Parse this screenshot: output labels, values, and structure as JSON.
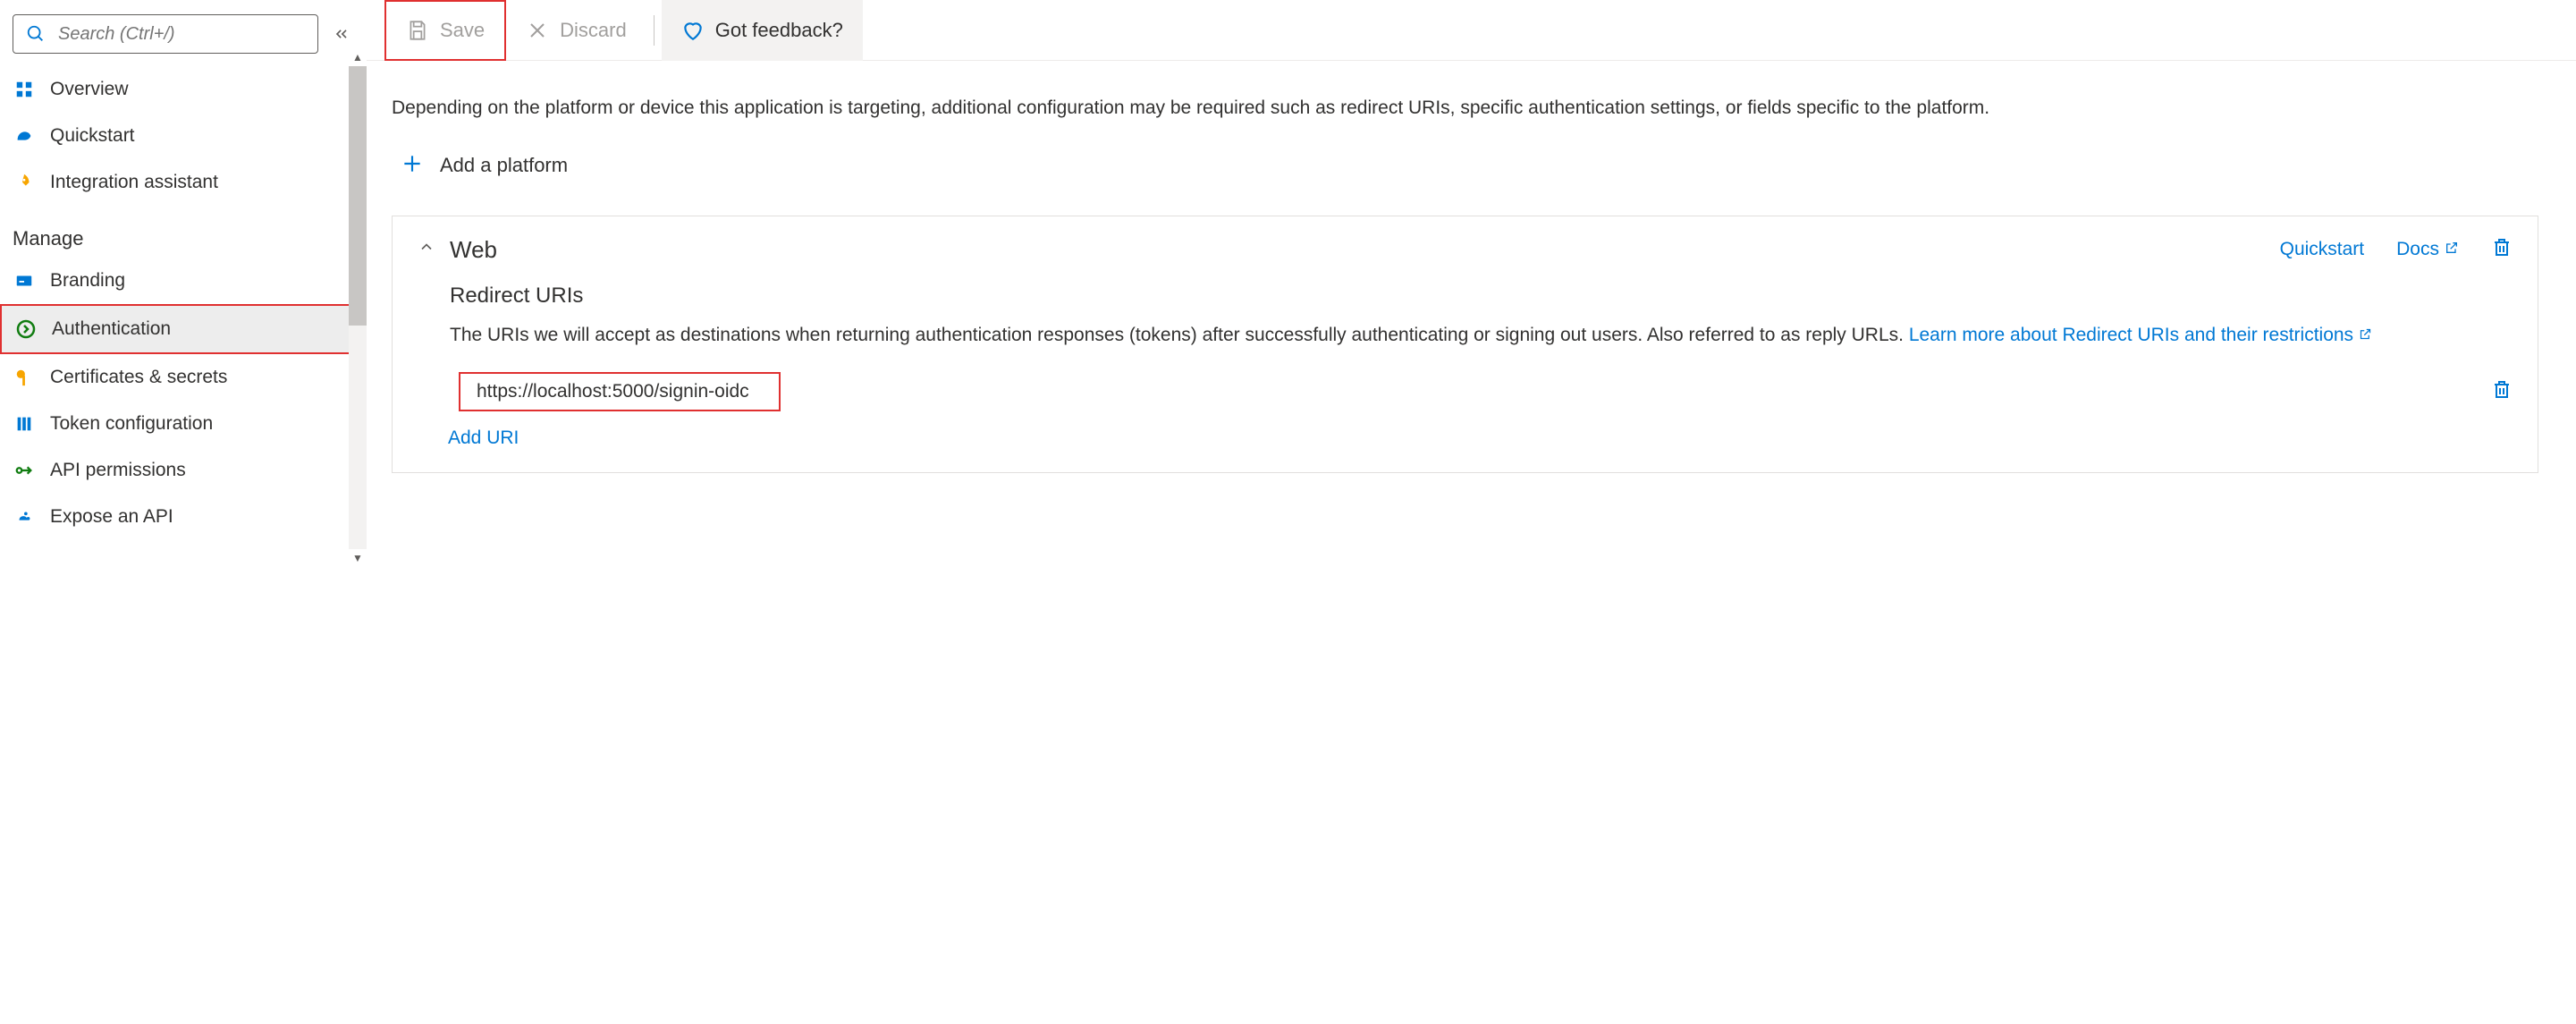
{
  "sidebar": {
    "search_placeholder": "Search (Ctrl+/)",
    "top_items": [
      {
        "icon": "overview",
        "label": "Overview"
      },
      {
        "icon": "quickstart",
        "label": "Quickstart"
      },
      {
        "icon": "integration",
        "label": "Integration assistant"
      }
    ],
    "section_header": "Manage",
    "manage_items": [
      {
        "icon": "branding",
        "label": "Branding"
      },
      {
        "icon": "auth",
        "label": "Authentication",
        "active": true,
        "highlight": true
      },
      {
        "icon": "certs",
        "label": "Certificates & secrets"
      },
      {
        "icon": "token",
        "label": "Token configuration"
      },
      {
        "icon": "apiperm",
        "label": "API permissions"
      },
      {
        "icon": "expose",
        "label": "Expose an API"
      }
    ]
  },
  "toolbar": {
    "save_label": "Save",
    "discard_label": "Discard",
    "feedback_label": "Got feedback?"
  },
  "content": {
    "description": "Depending on the platform or device this application is targeting, additional configuration may be required such as redirect URIs, specific authentication settings, or fields specific to the platform.",
    "add_platform_label": "Add a platform",
    "card": {
      "title": "Web",
      "quickstart_link": "Quickstart",
      "docs_link": "Docs",
      "redirect_section_title": "Redirect URIs",
      "redirect_desc_1": "The URIs we will accept as destinations when returning authentication responses (tokens) after successfully authenticating or signing out users. Also referred to as reply URLs. ",
      "redirect_learn_more": "Learn more about Redirect URIs and their restrictions",
      "uri_value": "https://localhost:5000/signin-oidc",
      "add_uri_label": "Add URI"
    }
  }
}
